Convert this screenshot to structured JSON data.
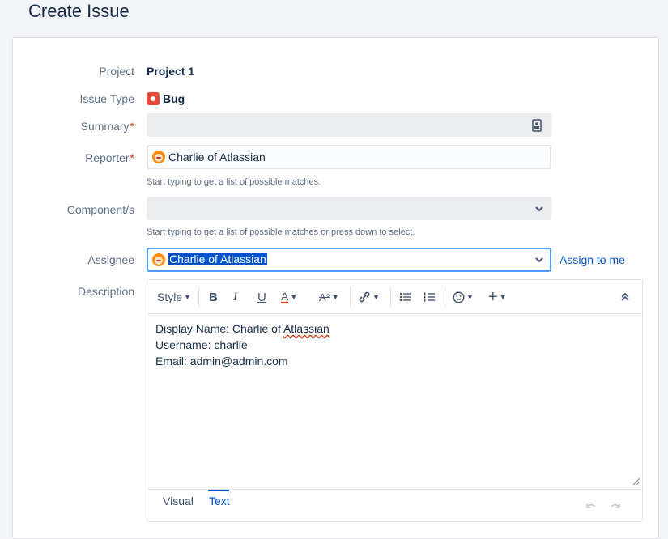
{
  "page": {
    "title": "Create Issue"
  },
  "form": {
    "project": {
      "label": "Project",
      "value": "Project 1"
    },
    "issue_type": {
      "label": "Issue Type",
      "value": "Bug",
      "icon": "bug-icon",
      "color": "#e5493a"
    },
    "summary": {
      "label": "Summary",
      "required_mark": "*",
      "value": ""
    },
    "reporter": {
      "label": "Reporter",
      "required_mark": "*",
      "value": "Charlie of Atlassian",
      "hint": "Start typing to get a list of possible matches."
    },
    "components": {
      "label": "Component/s",
      "value": "",
      "hint": "Start typing to get a list of possible matches or press down to select."
    },
    "assignee": {
      "label": "Assignee",
      "value": "Charlie of Atlassian",
      "assign_to_me": "Assign to me"
    },
    "description": {
      "label": "Description",
      "toolbar": {
        "style_label": "Style"
      },
      "lines": {
        "display_name_prefix": "Display Name: Charlie of ",
        "display_name_misspelled": "Atlassian",
        "username": "Username: charlie",
        "email": "Email: admin@admin.com"
      },
      "tabs": {
        "visual": "Visual",
        "text": "Text"
      }
    }
  },
  "colors": {
    "accent": "#0052cc",
    "required": "#de350b",
    "focus_border": "#4c9aff",
    "selection": "#0052cc"
  }
}
